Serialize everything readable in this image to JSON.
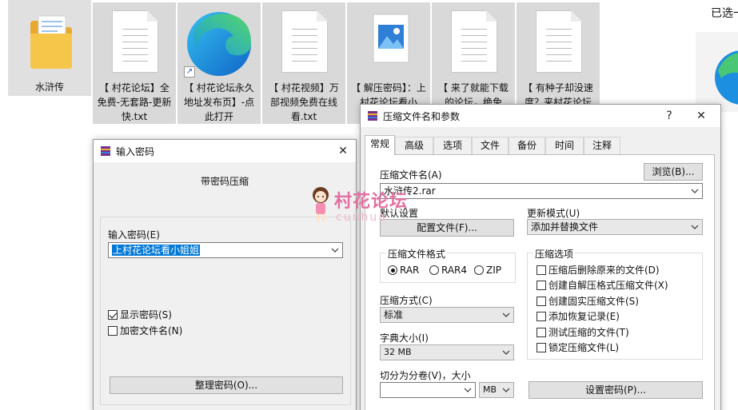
{
  "explorer": {
    "files": [
      {
        "name": "水浒传",
        "type": "folder"
      },
      {
        "name": "【 村花论坛】全免费-无套路-更新快.txt",
        "type": "text"
      },
      {
        "name": "【 村花论坛永久地址发布页】-点此打开",
        "type": "shortcut-edge"
      },
      {
        "name": "【 村花视频】万部视频免费在线看.txt",
        "type": "text"
      },
      {
        "name": "【 解压密码】：上村花论坛看小",
        "type": "image"
      },
      {
        "name": "【 来了就能下载的论坛，绝免",
        "type": "text"
      },
      {
        "name": "【 有种子却没速度？来村花论坛",
        "type": "text"
      }
    ],
    "selection_label": "已选一"
  },
  "password_dialog": {
    "title": "输入密码",
    "subtitle": "带密码压缩",
    "password_label": "输入密码(E)",
    "password_value": "上村花论坛看小姐姐",
    "show_password_label": "显示密码(S)",
    "show_password_checked": true,
    "encrypt_filenames_label": "加密文件名(N)",
    "encrypt_filenames_checked": false,
    "organize_button": "整理密码(O)..."
  },
  "archive_dialog": {
    "title": "压缩文件名和参数",
    "help_button": "?",
    "close_button": "✕",
    "tabs": [
      {
        "label": "常规",
        "active": true
      },
      {
        "label": "高级",
        "active": false
      },
      {
        "label": "选项",
        "active": false
      },
      {
        "label": "文件",
        "active": false
      },
      {
        "label": "备份",
        "active": false
      },
      {
        "label": "时间",
        "active": false
      },
      {
        "label": "注释",
        "active": false
      }
    ],
    "archive_name_label": "压缩文件名(A)",
    "browse_button": "浏览(B)...",
    "archive_name_value": "水浒传2.rar",
    "default_settings_label": "默认设置",
    "profile_button": "配置文件(F)...",
    "update_mode_label": "更新模式(U)",
    "update_mode_value": "添加并替换文件",
    "format_group_label": "压缩文件格式",
    "formats": [
      {
        "label": "RAR",
        "selected": true
      },
      {
        "label": "RAR4",
        "selected": false
      },
      {
        "label": "ZIP",
        "selected": false
      }
    ],
    "method_label": "压缩方式(C)",
    "method_value": "标准",
    "dict_label": "字典大小(I)",
    "dict_value": "32 MB",
    "split_label": "切分为分卷(V)，大小",
    "split_value": "",
    "split_unit": "MB",
    "options_group_label": "压缩选项",
    "options": [
      {
        "label": "压缩后删除原来的文件(D)",
        "checked": false
      },
      {
        "label": "创建自解压格式压缩文件(X)",
        "checked": false
      },
      {
        "label": "创建固实压缩文件(S)",
        "checked": false
      },
      {
        "label": "添加恢复记录(E)",
        "checked": false
      },
      {
        "label": "测试压缩的文件(T)",
        "checked": false
      },
      {
        "label": "锁定压缩文件(L)",
        "checked": false
      }
    ],
    "set_password_button": "设置密码(P)..."
  },
  "watermark": {
    "text": "村花论坛",
    "sub": "cunhua"
  },
  "colors": {
    "selection_blue": "#0078d7",
    "watermark_pink": "#e46fa2",
    "folder_yellow": "#f6c64a"
  }
}
